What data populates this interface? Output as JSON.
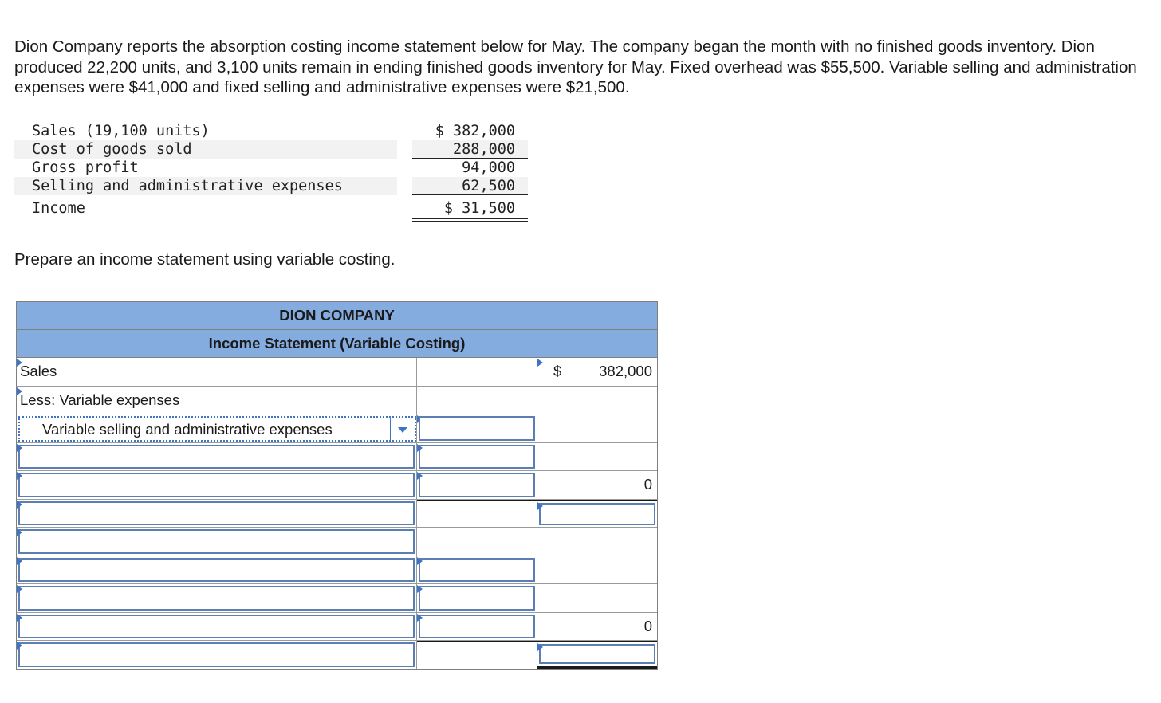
{
  "intro_text": "Dion Company reports the absorption costing income statement below for May. The company began the month with no finished goods inventory. Dion produced 22,200 units, and 3,100 units remain in ending finished goods inventory for May. Fixed overhead was $55,500. Variable selling and administration expenses were $41,000 and fixed selling and administrative expenses were $21,500.",
  "absorption_statement": [
    {
      "label": "Sales (19,100 units)",
      "value": "$ 382,000"
    },
    {
      "label": "Cost of goods sold",
      "value": "288,000"
    },
    {
      "label": "Gross profit",
      "value": "94,000"
    },
    {
      "label": "Selling and administrative expenses",
      "value": "62,500"
    },
    {
      "label": "Income",
      "value": "$ 31,500"
    }
  ],
  "prompt": "Prepare an income statement using variable costing.",
  "variable_statement": {
    "company": "DION COMPANY",
    "title": "Income Statement (Variable Costing)",
    "rows": [
      {
        "label": "Sales",
        "col2": "",
        "currency": "$",
        "col3": "382,000"
      },
      {
        "label": "Less: Variable expenses",
        "col2": "",
        "col3": ""
      },
      {
        "label": "Variable selling and administrative expenses",
        "col2": "",
        "col3": ""
      },
      {
        "label": "",
        "col2": "",
        "col3": ""
      },
      {
        "label": "",
        "col2": "",
        "col3": "0"
      },
      {
        "label": "",
        "col2": "",
        "col3": ""
      },
      {
        "label": "",
        "col2": "",
        "col3": ""
      },
      {
        "label": "",
        "col2": "",
        "col3": ""
      },
      {
        "label": "",
        "col2": "",
        "col3": ""
      },
      {
        "label": "",
        "col2": "",
        "col3": "0"
      },
      {
        "label": "",
        "col2": "",
        "col3": ""
      }
    ]
  }
}
